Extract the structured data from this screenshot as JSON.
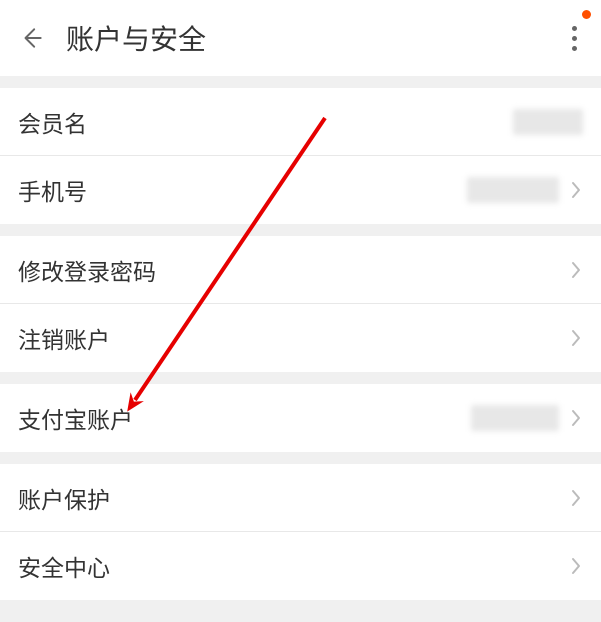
{
  "header": {
    "title": "账户与安全"
  },
  "group1": {
    "member_name_label": "会员名",
    "phone_label": "手机号"
  },
  "group2": {
    "change_password_label": "修改登录密码",
    "delete_account_label": "注销账户"
  },
  "group3": {
    "alipay_account_label": "支付宝账户"
  },
  "group4": {
    "account_protection_label": "账户保护",
    "security_center_label": "安全中心"
  },
  "annotation": {
    "arrow_color": "#e60000"
  }
}
